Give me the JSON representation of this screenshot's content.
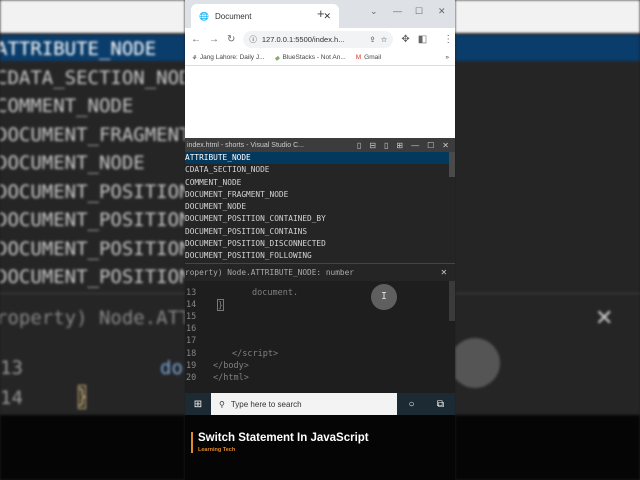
{
  "browser": {
    "tab_title": "Document",
    "url": "127.0.0.1:5500/index.h...",
    "bookmarks": [
      "Jang Lahore: Daily J...",
      "BlueStacks - Not An...",
      "Gmail"
    ]
  },
  "vscode": {
    "title": "index.html - shorts - Visual Studio C...",
    "suggestions": [
      "ATTRIBUTE_NODE",
      "CDATA_SECTION_NODE",
      "COMMENT_NODE",
      "DOCUMENT_FRAGMENT_NODE",
      "DOCUMENT_NODE",
      "DOCUMENT_POSITION_CONTAINED_BY",
      "DOCUMENT_POSITION_CONTAINS",
      "DOCUMENT_POSITION_DISCONNECTED",
      "DOCUMENT_POSITION_FOLLOWING"
    ],
    "detail": "roperty) Node.ATTRIBUTE_NODE: number",
    "lines": [
      {
        "n": "13",
        "code": "document."
      },
      {
        "n": "14",
        "code": "}"
      },
      {
        "n": "15",
        "code": ""
      },
      {
        "n": "16",
        "code": ""
      },
      {
        "n": "17",
        "code": ""
      },
      {
        "n": "18",
        "code": "</script>"
      },
      {
        "n": "19",
        "code": "</body>"
      },
      {
        "n": "20",
        "code": "</html>"
      }
    ]
  },
  "taskbar": {
    "search_placeholder": "Type here to search"
  },
  "caption": {
    "title": "Switch Statement In JavaScript",
    "channel": "Learning Tech"
  },
  "background": {
    "list": [
      "ATTRIBUTE_NODE",
      "CDATA_SECTION_NODE",
      "COMMENT_NODE",
      "DOCUMENT_FRAGMENT_NODE",
      "DOCUMENT_NODE",
      "DOCUMENT_POSITION_CONTAINED_BY",
      "DOCUMENT_POSITION_CONTAINS",
      "DOCUMENT_POSITION_DISCONNECTED",
      "DOCUMENT_POSITION_FOLLOWING"
    ],
    "prop": "roperty) Node.ATTRIBUTE_NODE: number",
    "ln13": "13",
    "ln14": "14",
    "doc": "document."
  }
}
